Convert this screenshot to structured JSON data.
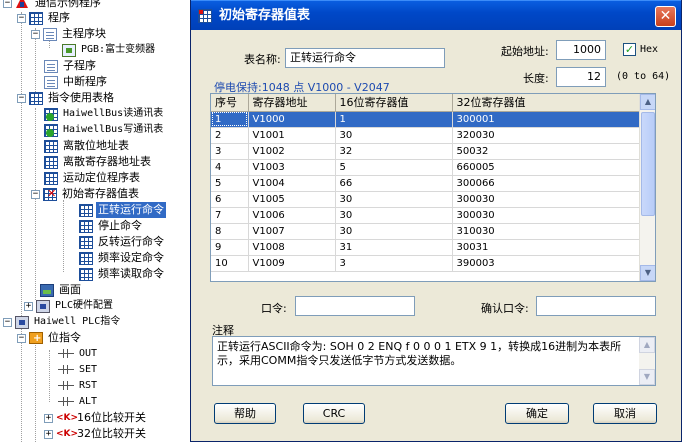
{
  "tree": {
    "root": "通信示例程序",
    "program": "程序",
    "main_block": "主程序块",
    "pgb": "PGB:富士变频器",
    "sub_program": "子程序",
    "interrupt": "中断程序",
    "instr_table": "指令使用表格",
    "haiwell_read": "HaiwellBus读通讯表",
    "haiwell_write": "HaiwellBus写通讯表",
    "discrete_bit": "离散位地址表",
    "discrete_reg": "离散寄存器地址表",
    "motion_table": "运动定位程序表",
    "init_reg_table": "初始寄存器值表",
    "init_children": [
      "正转运行命令",
      "停止命令",
      "反转运行命令",
      "频率设定命令",
      "频率读取命令"
    ],
    "screen": "画面",
    "plc_hw": "PLC硬件配置",
    "haiwell_plc": "Haiwell PLC指令",
    "bit_instr": "位指令",
    "bit_children": [
      "OUT",
      "SET",
      "RST",
      "ALT"
    ],
    "cmp16": "16位比较开关",
    "cmp32": "32位比较开关"
  },
  "dialog": {
    "title": "初始寄存器值表",
    "table_name_label": "表名称:",
    "table_name_value": "正转运行命令",
    "start_addr_label": "起始地址:",
    "start_addr_value": "1000",
    "hex_label": "Hex",
    "hex_checked": true,
    "length_label": "长度:",
    "length_value": "12",
    "length_range": "(0 to 64)",
    "retain_info": "停电保持:1048 点 V1000 - V2047",
    "columns": [
      "序号",
      "寄存器地址",
      "16位寄存器值",
      "32位寄存器值"
    ],
    "rows": [
      [
        "1",
        "V1000",
        "1",
        "300001"
      ],
      [
        "2",
        "V1001",
        "30",
        "320030"
      ],
      [
        "3",
        "V1002",
        "32",
        "50032"
      ],
      [
        "4",
        "V1003",
        "5",
        "660005"
      ],
      [
        "5",
        "V1004",
        "66",
        "300066"
      ],
      [
        "6",
        "V1005",
        "30",
        "300030"
      ],
      [
        "7",
        "V1006",
        "30",
        "300030"
      ],
      [
        "8",
        "V1007",
        "30",
        "310030"
      ],
      [
        "9",
        "V1008",
        "31",
        "30031"
      ],
      [
        "10",
        "V1009",
        "3",
        "390003"
      ]
    ],
    "password_label": "口令:",
    "password_value": "",
    "confirm_label": "确认口令:",
    "confirm_value": "",
    "notes_label": "注释",
    "notes_text": "正转运行ASCII命令为: SOH 0 2 ENQ f 0 0 0 1 ETX 9 1，转换成16进制为本表所示，采用COMM指令只发送低字节方式发送数据。",
    "help_btn": "帮助",
    "crc_btn": "CRC",
    "ok_btn": "确定",
    "cancel_btn": "取消"
  },
  "colors": {
    "titlebar": "#0048c8",
    "selection": "#316ac5",
    "dialog_bg": "#ece9d8",
    "info_blue": "#1e4bb0"
  }
}
